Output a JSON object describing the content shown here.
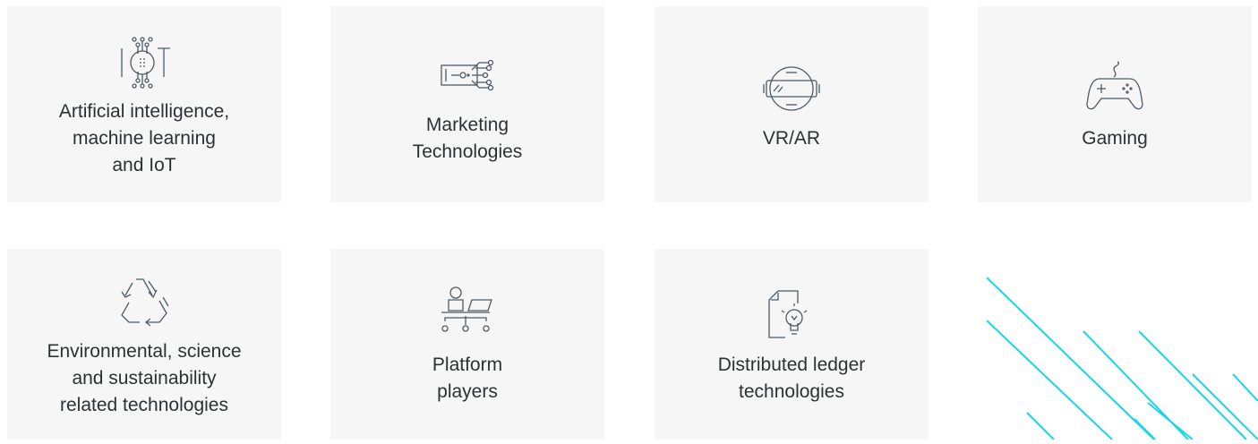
{
  "accent_color": "#17d6e6",
  "icon_color": "#4d5a66",
  "cards": [
    {
      "label": "Artificial intelligence,\nmachine learning\nand IoT",
      "icon": "iot-circuit-icon"
    },
    {
      "label": "Marketing\nTechnologies",
      "icon": "marketing-tech-icon"
    },
    {
      "label": "VR/AR",
      "icon": "vr-headset-icon"
    },
    {
      "label": "Gaming",
      "icon": "gamepad-icon"
    },
    {
      "label": "Environmental, science\nand sustainability\nrelated technologies",
      "icon": "recycle-icon"
    },
    {
      "label": "Platform\nplayers",
      "icon": "platform-network-icon"
    },
    {
      "label": "Distributed ledger\ntechnologies",
      "icon": "document-lightbulb-icon"
    }
  ]
}
